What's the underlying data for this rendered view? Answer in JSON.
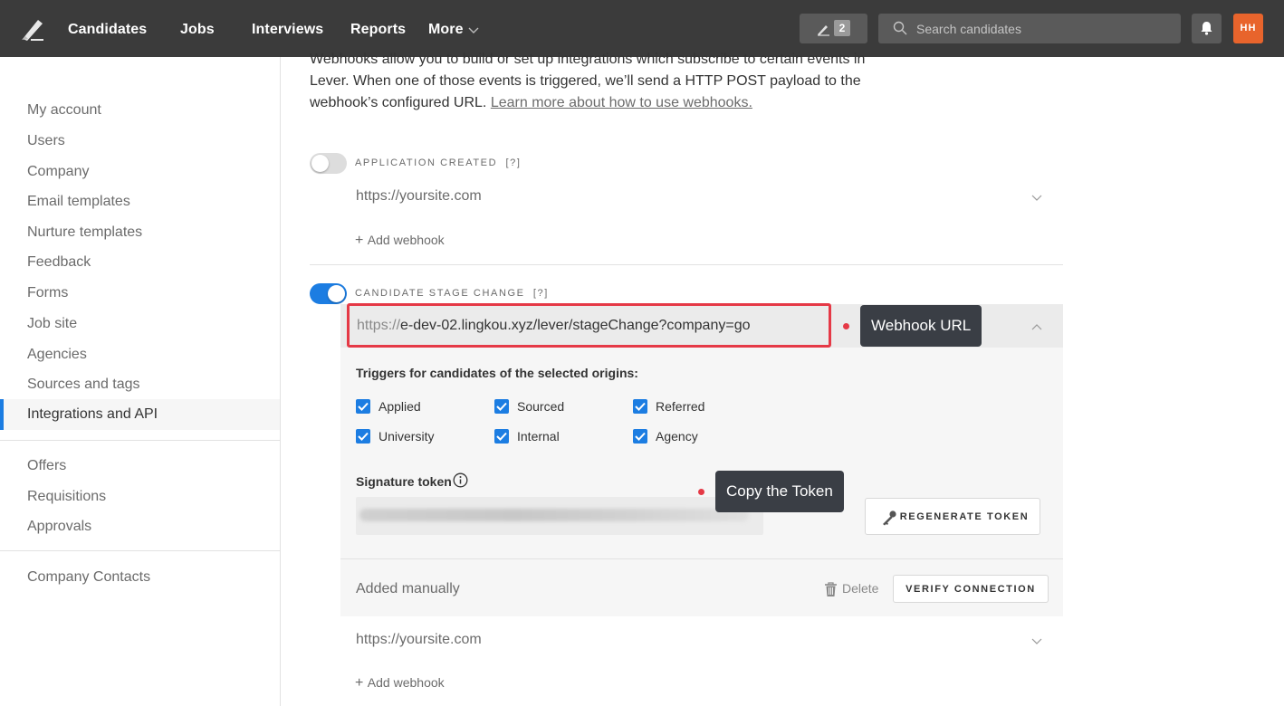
{
  "nav": {
    "items": [
      "Candidates",
      "Jobs",
      "Interviews",
      "Reports",
      "More"
    ],
    "notes_count": "2",
    "search_placeholder": "Search candidates",
    "avatar_initials": "HH"
  },
  "sidebar": {
    "group1": [
      "My account",
      "Users",
      "Company",
      "Email templates",
      "Nurture templates",
      "Feedback",
      "Forms",
      "Job site",
      "Agencies",
      "Sources and tags"
    ],
    "active": "Integrations and API",
    "group2": [
      "Offers",
      "Requisitions",
      "Approvals"
    ],
    "group3": [
      "Company Contacts"
    ]
  },
  "main": {
    "intro_text": "Webhooks allow you to build or set up integrations which subscribe to certain events in Lever. When one of those events is triggered, we’ll send a HTTP POST payload to the webhook’s configured URL. ",
    "intro_link": "Learn more about how to use webhooks.",
    "section1": {
      "label": "APPLICATION CREATED",
      "help": "[?]",
      "toggle_on": false,
      "url_placeholder": "https://yoursite.com",
      "add_webhook": "Add webhook"
    },
    "section2": {
      "label": "CANDIDATE STAGE CHANGE",
      "help": "[?]",
      "toggle_on": true,
      "url_protocol": "https://",
      "url_rest": "e-dev-02.lingkou.xyz/lever/stageChange?company=go",
      "triggers_title": "Triggers for candidates of the selected origins:",
      "triggers": [
        {
          "label": "Applied",
          "checked": true
        },
        {
          "label": "Sourced",
          "checked": true
        },
        {
          "label": "Referred",
          "checked": true
        },
        {
          "label": "University",
          "checked": true
        },
        {
          "label": "Internal",
          "checked": true
        },
        {
          "label": "Agency",
          "checked": true
        }
      ],
      "signature_title": "Signature token",
      "regenerate_label": "REGENERATE TOKEN",
      "added_manually": "Added manually",
      "delete_label": "Delete",
      "verify_label": "VERIFY CONNECTION",
      "url_placeholder": "https://yoursite.com",
      "add_webhook": "Add webhook"
    }
  },
  "annotations": {
    "webhook_url": "Webhook URL",
    "copy_token": "Copy the Token"
  },
  "colors": {
    "topbar": "#3b3b3b",
    "accent_blue": "#1c7de2",
    "highlight_red": "#e53946",
    "avatar_orange": "#e8642c",
    "callout_bg": "#3a3e45"
  }
}
